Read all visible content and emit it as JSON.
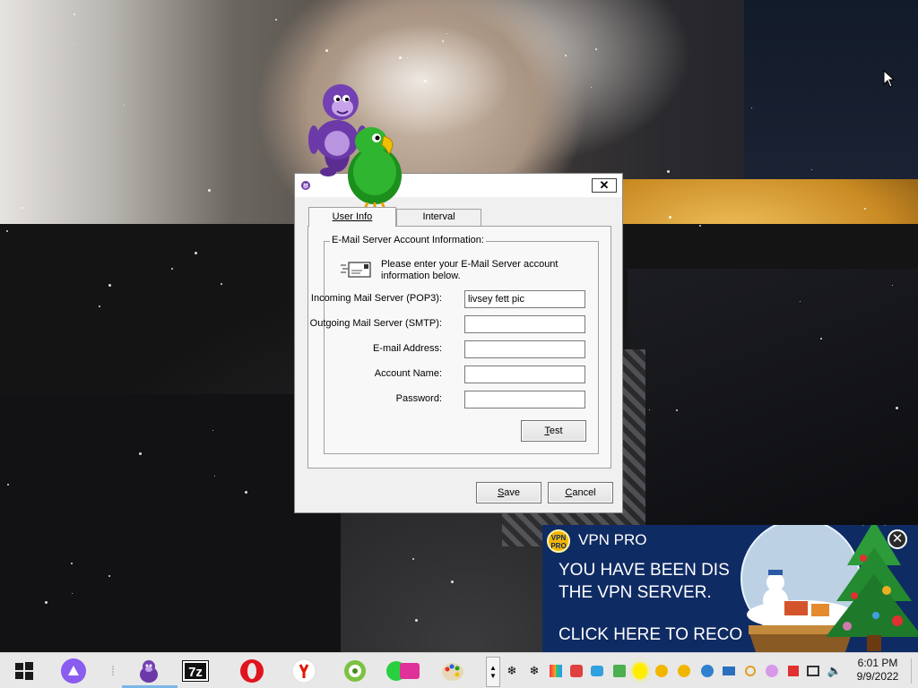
{
  "dialog": {
    "tabs": [
      {
        "label": "User Info",
        "active": true
      },
      {
        "label": "Interval",
        "active": false
      }
    ],
    "close_glyph": "✕",
    "group_title": "E-Mail Server Account Information:",
    "intro": "Please enter your E-Mail Server account information below.",
    "fields": {
      "pop3": {
        "label": "Incoming Mail Server (POP3):",
        "value": "livsey fett pic"
      },
      "smtp": {
        "label": "Outgoing Mail Server (SMTP):",
        "value": ""
      },
      "email": {
        "label": "E-mail Address:",
        "value": ""
      },
      "account": {
        "label": "Account Name:",
        "value": ""
      },
      "password": {
        "label": "Password:",
        "value": ""
      }
    },
    "buttons": {
      "test": {
        "mnemonic": "T",
        "rest": "est"
      },
      "save": {
        "mnemonic": "S",
        "rest": "ave"
      },
      "cancel": {
        "mnemonic": "C",
        "rest": "ancel"
      }
    }
  },
  "vpn_popup": {
    "logo_line1": "VPN",
    "logo_line2": "PRO",
    "title": "VPN PRO",
    "message_line1": "YOU HAVE BEEN DIS",
    "message_line2": "THE VPN SERVER.",
    "message_line3": "CLICK HERE TO RECO",
    "close_glyph": "✕"
  },
  "taskbar": {
    "app_7zip_label": "7z",
    "clock_time": "6:01 PM",
    "clock_date": "9/9/2022",
    "pinned_icons": [
      "windows-start-icon",
      "cortana-icon",
      "bonzibuddy-icon",
      "7zip-icon",
      "opera-icon",
      "yandex-icon",
      "cd-burner-icon",
      "fast-video-icon",
      "paint-icon"
    ],
    "accent_colors": {
      "vpn_bg": "#0f2b63",
      "vpn_logo": "#f2b600",
      "taskbar_bg": "#e8e8e8"
    }
  }
}
